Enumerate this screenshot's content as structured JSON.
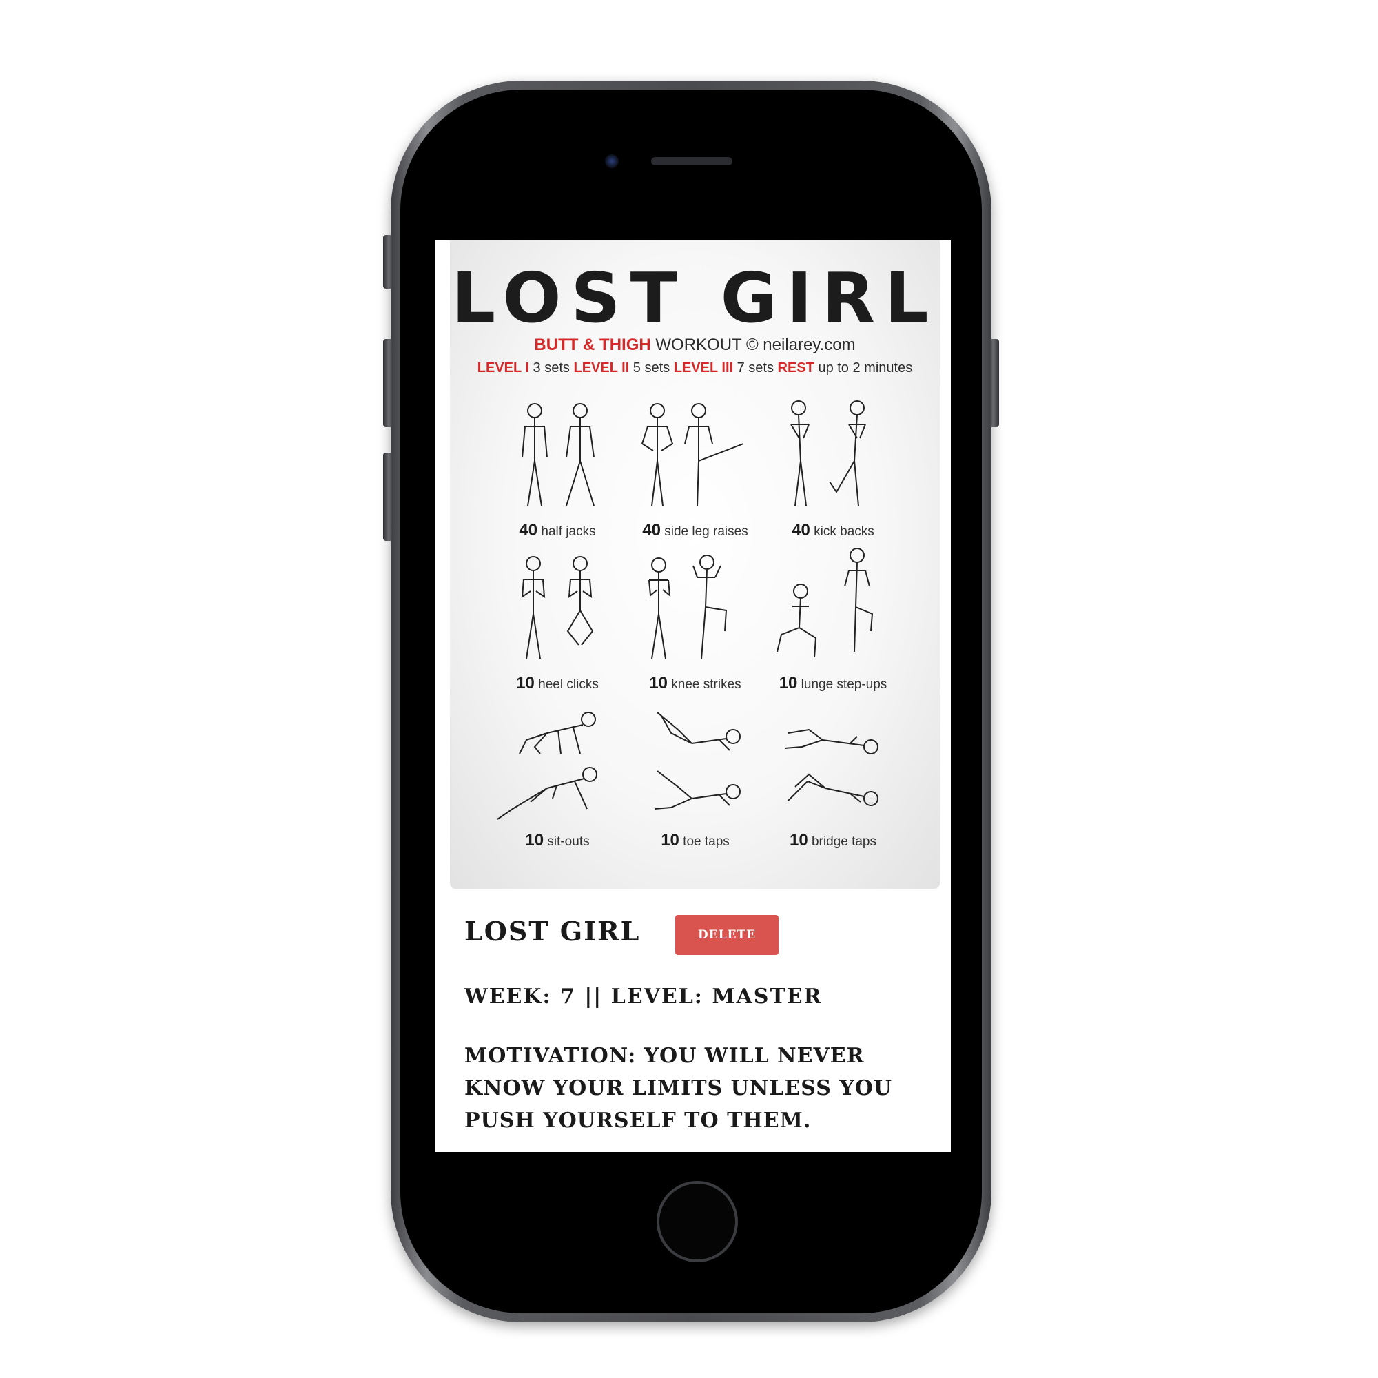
{
  "poster": {
    "title": "LOST GIRL",
    "sub_red": "BUTT & THIGH",
    "sub_workout": " WORKOUT © neilarey.com",
    "levels": [
      {
        "label": "LEVEL I",
        "value": " 3 sets "
      },
      {
        "label": "LEVEL II",
        "value": " 5 sets "
      },
      {
        "label": "LEVEL III",
        "value": " 7 sets "
      },
      {
        "label": "REST",
        "value": " up to 2 minutes"
      }
    ],
    "exercises": [
      {
        "count": "40",
        "name": " half jacks"
      },
      {
        "count": "40",
        "name": " side leg raises"
      },
      {
        "count": "40",
        "name": " kick backs"
      },
      {
        "count": "10",
        "name": " heel clicks"
      },
      {
        "count": "10",
        "name": " knee strikes"
      },
      {
        "count": "10",
        "name": " lunge step-ups"
      },
      {
        "count": "10",
        "name": " sit-outs"
      },
      {
        "count": "10",
        "name": " toe taps"
      },
      {
        "count": "10",
        "name": " bridge taps"
      }
    ]
  },
  "workout": {
    "title": "LOST GIRL",
    "delete_label": "DELETE",
    "week_level": "WEEK: 7 || LEVEL: MASTER",
    "motivation": "MOTIVATION: YOU WILL NEVER KNOW YOUR LIMITS UNLESS YOU PUSH YOURSELF TO THEM."
  },
  "colors": {
    "delete_button": "#d9534f",
    "poster_accent": "#d62828"
  }
}
